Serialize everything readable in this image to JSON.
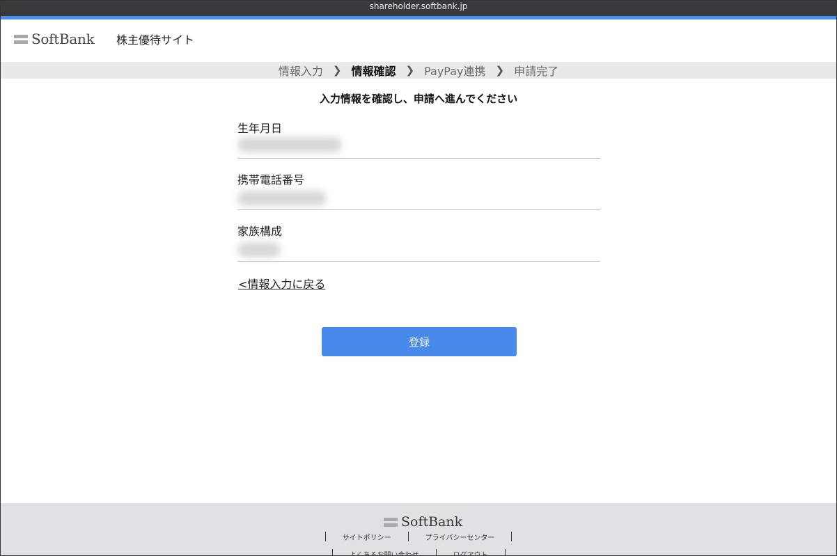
{
  "browser": {
    "url": "shareholder.softbank.jp"
  },
  "header": {
    "logo_text": "SoftBank",
    "site_title": "株主優待サイト"
  },
  "steps": [
    {
      "label": "情報入力",
      "active": false
    },
    {
      "label": "情報確認",
      "active": true
    },
    {
      "label": "PayPay連携",
      "active": false
    },
    {
      "label": "申請完了",
      "active": false
    }
  ],
  "main": {
    "heading": "入力情報を確認し、申請へ進んでください",
    "fields": [
      {
        "label": "生年月日"
      },
      {
        "label": "携帯電話番号"
      },
      {
        "label": "家族構成"
      }
    ],
    "back_link": "<情報入力に戻る",
    "submit_label": "登録"
  },
  "footer": {
    "logo_text": "SoftBank",
    "links_row1": [
      "サイトポリシー",
      "プライバシーセンター"
    ],
    "links_row2": [
      "よくあるお問い合わせ",
      "ログアウト"
    ]
  },
  "colors": {
    "accent": "#4a8ef0",
    "button": "#4889ec",
    "step_bar": "#e9e9ea",
    "footer_bg": "#e1e1e5"
  }
}
